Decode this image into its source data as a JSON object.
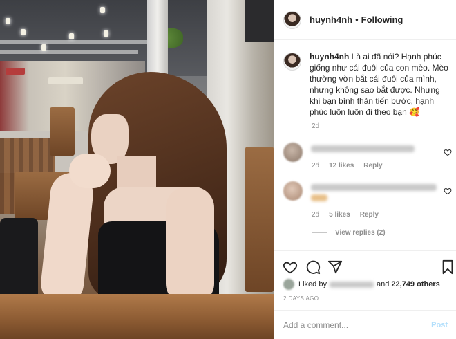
{
  "header": {
    "username": "huynh4nh",
    "separator": "•",
    "follow_status": "Following"
  },
  "caption": {
    "username": "huynh4nh",
    "text": "Là ai đã nói? Hạnh phúc giống như cái đuôi của con mèo. Mèo thường vờn bắt cái đuôi của mình, nhưng không sao bắt được. Nhưng khi bạn bình thản tiến bước, hạnh phúc luôn luôn đi theo bạn 🥰",
    "age": "2d"
  },
  "comments": [
    {
      "age": "2d",
      "likes": "12 likes",
      "reply": "Reply"
    },
    {
      "age": "2d",
      "likes": "5 likes",
      "reply": "Reply"
    }
  ],
  "view_replies": "View replies (2)",
  "liked": {
    "prefix": "Liked by",
    "and_text": "and",
    "count": "22,749 others"
  },
  "date": "2 DAYS AGO",
  "add_comment": {
    "placeholder": "Add a comment...",
    "post_label": "Post"
  },
  "icons": {
    "like": "heart-icon",
    "comment": "comment-bubble-icon",
    "share": "paper-plane-icon",
    "save": "bookmark-icon"
  },
  "colors": {
    "text": "#262626",
    "muted": "#8e8e8e",
    "post_disabled": "#b2dffc"
  }
}
